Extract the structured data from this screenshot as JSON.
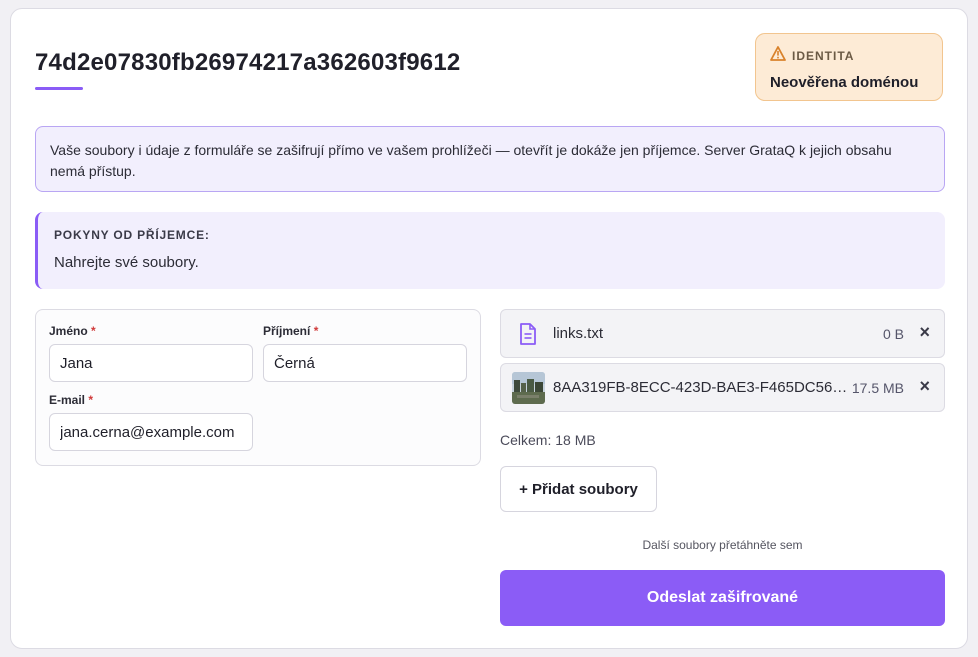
{
  "header": {
    "title": "74d2e07830fb26974217a362603f9612"
  },
  "identity": {
    "label": "IDENTITA",
    "value": "Neověřena doménou",
    "icon": "warning-icon",
    "color": "#d9822b"
  },
  "encryption_notice": "Vaše soubory i údaje z formuláře se zašifrují přímo ve vašem prohlížeči — otevřít je dokáže jen příjemce. Server GrataQ k jejich obsahu nemá přístup.",
  "instructions": {
    "title": "POKYNY OD PŘÍJEMCE:",
    "text": "Nahrejte své soubory."
  },
  "form": {
    "first_name": {
      "label": "Jméno",
      "required_mark": "*",
      "value": "Jana"
    },
    "last_name": {
      "label": "Příjmení",
      "required_mark": "*",
      "value": "Černá"
    },
    "email": {
      "label": "E-mail",
      "required_mark": "*",
      "value": "jana.cerna@example.com"
    }
  },
  "files": [
    {
      "name": "links.txt",
      "size": "0 B",
      "icon": "text-file-icon",
      "remove": "×"
    },
    {
      "name": "8AA319FB-8ECC-423D-BAE3-F465DC56…",
      "size": "17.5 MB",
      "icon": "image-thumbnail",
      "remove": "×"
    }
  ],
  "total": "Celkem: 18 MB",
  "add_files_label": "+ Přidat soubory",
  "drop_hint": "Další soubory přetáhněte sem",
  "submit_label": "Odeslat zašifrované",
  "colors": {
    "accent": "#8b5cf6",
    "warning_bg": "#fdebd6",
    "required": "#d03a3a"
  }
}
